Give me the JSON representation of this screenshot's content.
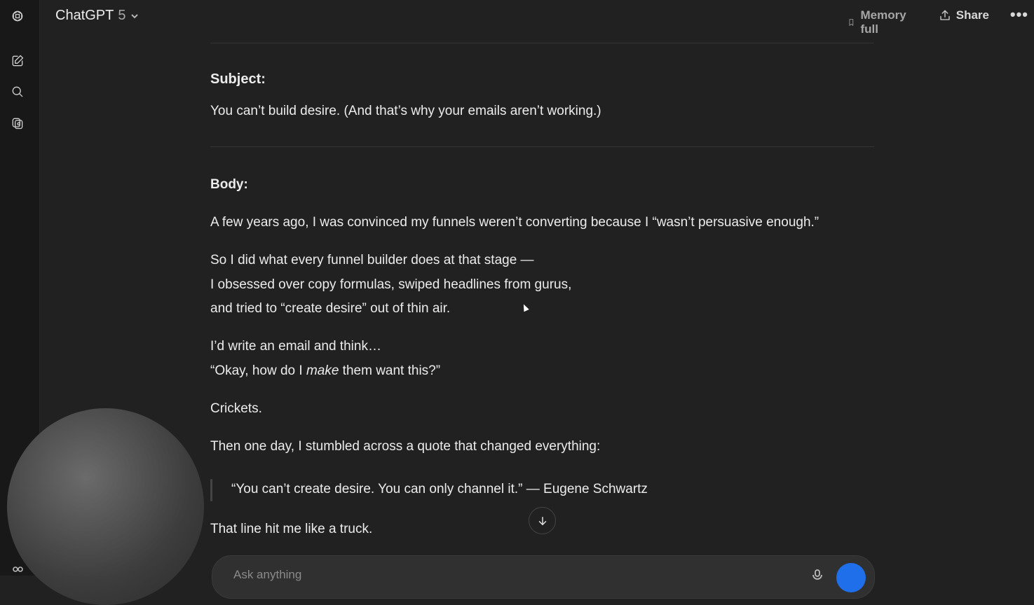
{
  "header": {
    "model_name": "ChatGPT",
    "model_version": "5",
    "memory_label": "Memory full",
    "share_label": "Share"
  },
  "message": {
    "subject_label": "Subject:",
    "subject_text": "You can’t build desire. (And that’s why your emails aren’t working.)",
    "body_label": "Body:",
    "para1": "A few years ago, I was convinced my funnels weren’t converting because I “wasn’t persuasive enough.”",
    "para2_line1": "So I did what every funnel builder does at that stage —",
    "para2_line2": "I obsessed over copy formulas, swiped headlines from gurus,",
    "para2_line3": "and tried to “create desire” out of thin air.",
    "para3_line1": "I’d write an email and think…",
    "para3_line2_pre": "“Okay, how do I ",
    "para3_line2_em": "make",
    "para3_line2_post": " them want this?”",
    "para4": "Crickets.",
    "para5": "Then one day, I stumbled across a quote that changed everything:",
    "quote": "“You can’t create desire. You can only channel it.” — Eugene Schwartz",
    "para6": "That line hit me like a truck."
  },
  "composer": {
    "placeholder": "Ask anything"
  },
  "icons": {
    "logo": "openai-logo-icon",
    "new_chat": "new-chat-icon",
    "search": "search-icon",
    "library": "library-icon",
    "memory": "memory-icon",
    "share": "share-icon",
    "more": "more-icon",
    "scroll": "arrow-down-icon"
  },
  "colors": {
    "background": "#212121",
    "sidebar": "#181818",
    "send_button": "#1f6feb"
  }
}
